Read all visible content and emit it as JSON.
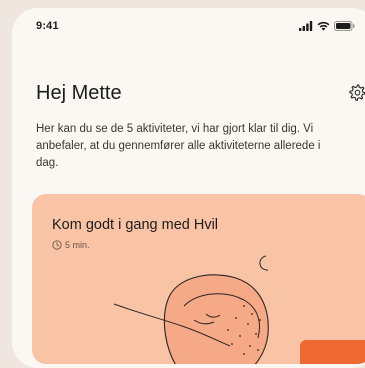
{
  "status_bar": {
    "time": "9:41",
    "icons": [
      "signal-icon",
      "wifi-icon",
      "battery-icon"
    ]
  },
  "header": {
    "greeting": "Hej Mette",
    "settings_icon": "gear-icon"
  },
  "intro": {
    "text": "Her kan du se de 5 aktiviteter, vi har gjort klar til dig. Vi anbefaler, at du gennemfører alle aktiviteterne allerede i dag."
  },
  "activity_card": {
    "title": "Kom godt i gang med Hvil",
    "duration": "5 min.",
    "duration_icon": "clock-icon",
    "illustration": "sleeping-person-moon-illustration",
    "background_color": "#f9c4a5",
    "accent_color": "#ef6a33"
  }
}
